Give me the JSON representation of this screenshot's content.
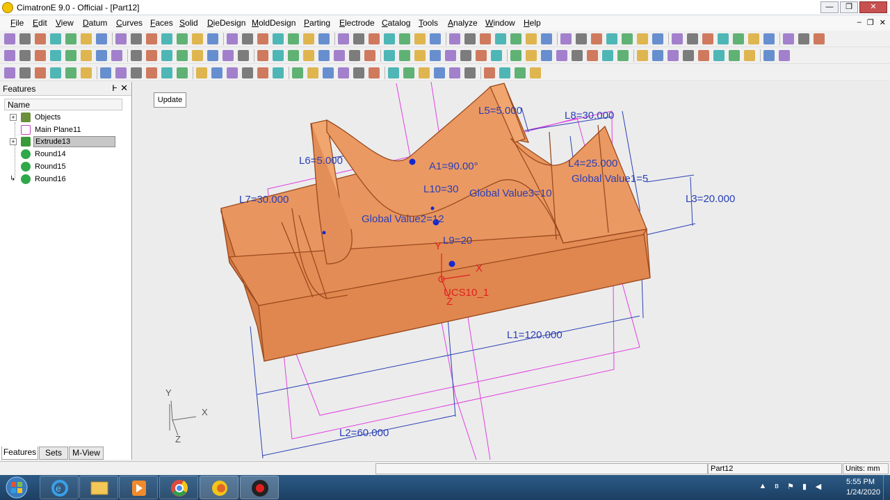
{
  "window": {
    "title": "CimatronE 9.0 - Official - [Part12]",
    "minimize": "—",
    "maximize": "❐",
    "close": "✕"
  },
  "menu": [
    "File",
    "Edit",
    "View",
    "Datum",
    "Curves",
    "Faces",
    "Solid",
    "DieDesign",
    "MoldDesign",
    "Parting",
    "Electrode",
    "Catalog",
    "Tools",
    "Analyze",
    "Window",
    "Help"
  ],
  "mdi_controls": [
    "–",
    "❐",
    "✕"
  ],
  "panel": {
    "title": "Features",
    "pin": "Ͱ",
    "close": "✕",
    "column_header": "Name",
    "tree": [
      {
        "label": "Objects",
        "expandable": true,
        "icon_color": "#6b8f3a"
      },
      {
        "label": "Main Plane11",
        "expandable": false,
        "icon_color": "#c040c0"
      },
      {
        "label": "Extrude13",
        "expandable": true,
        "icon_color": "#3a9a3a",
        "selected": true
      },
      {
        "label": "Round14",
        "expandable": false,
        "icon_color": "#2fa84a"
      },
      {
        "label": "Round15",
        "expandable": false,
        "icon_color": "#2fa84a"
      },
      {
        "label": "Round16",
        "expandable": false,
        "icon_color": "#2fa84a"
      }
    ],
    "tabs": [
      "Features",
      "Sets",
      "M-View"
    ]
  },
  "viewport": {
    "update_button": "Update",
    "dimensions": {
      "l5": "L5=5.000",
      "l8": "L8=30.000",
      "l6": "L6=5.000",
      "a1": "A1=90.00°",
      "l4": "L4=25.000",
      "global1": "Global Value1=5",
      "l7": "L7=30.000",
      "l10": "L10=30",
      "global3": "Global Value3=10",
      "l3": "L3=20.000",
      "global2": "Global Value2=12",
      "l9": "L9=20",
      "l1": "L1=120.000",
      "l2": "L2=60.000"
    },
    "ucs": {
      "name": "UCS10_1",
      "x": "X",
      "y": "Y",
      "z": "Z"
    },
    "triad": {
      "x": "X",
      "y": "Y",
      "z": "Z"
    },
    "colors": {
      "solid_face": "#e8955f",
      "solid_edge": "#9b4a1e",
      "dimension": "#2a3fb5",
      "plane": "#e040e0",
      "ucs": "#e02020"
    }
  },
  "status": {
    "part": "Part12",
    "units": "Units: mm"
  },
  "taskbar": {
    "apps": [
      "start",
      "internet-explorer",
      "file-explorer",
      "media-player",
      "chrome",
      "cimatron-launcher",
      "screen-recorder"
    ],
    "time": "5:55 PM",
    "date": "1/24/2020"
  }
}
